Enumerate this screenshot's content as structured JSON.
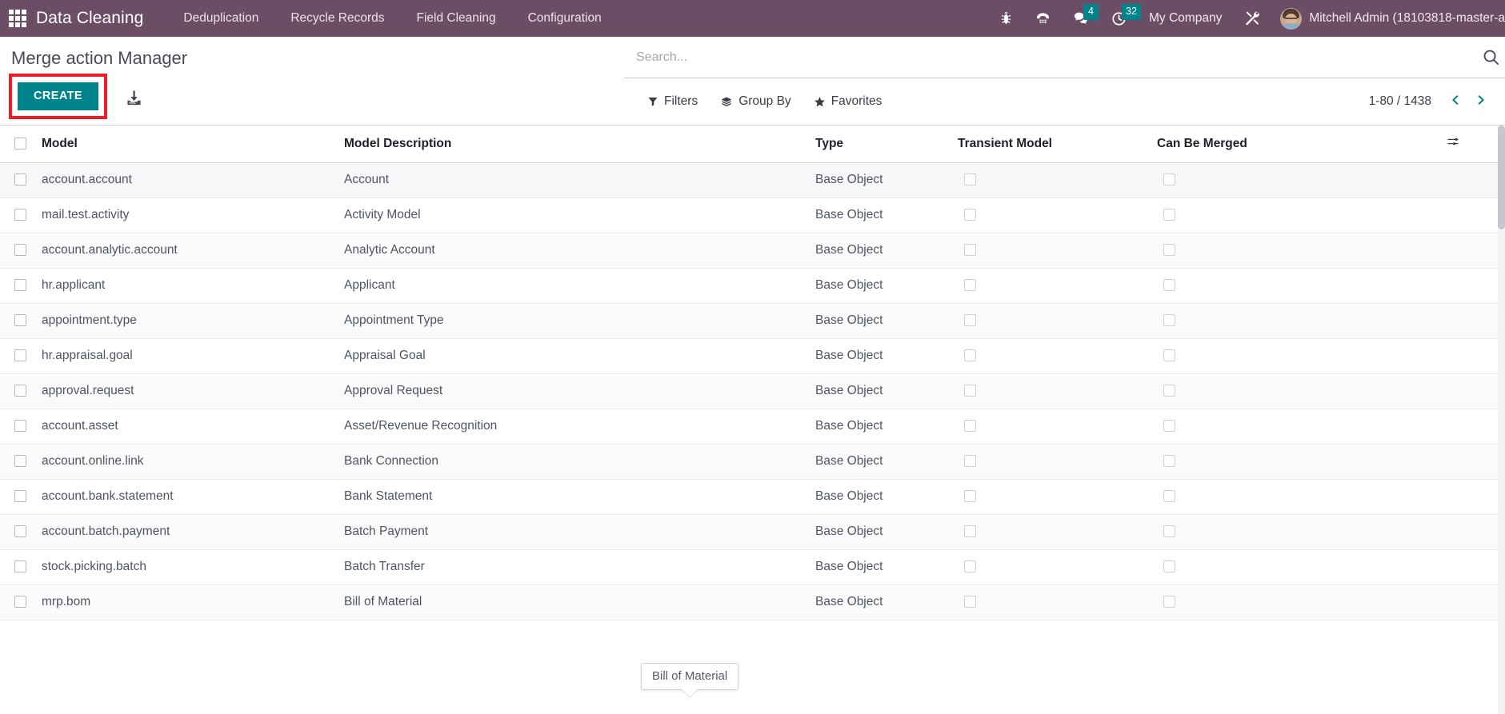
{
  "navbar": {
    "apps_icon": "apps-grid-icon",
    "brand": "Data Cleaning",
    "menu": [
      {
        "label": "Deduplication"
      },
      {
        "label": "Recycle Records"
      },
      {
        "label": "Field Cleaning"
      },
      {
        "label": "Configuration"
      }
    ],
    "systray": [
      {
        "name": "bug-icon",
        "badge": null
      },
      {
        "name": "voip-phone-icon",
        "badge": null
      },
      {
        "name": "messaging-chat-icon",
        "badge": "4"
      },
      {
        "name": "activities-clock-icon",
        "badge": "32"
      }
    ],
    "company": "My Company",
    "debug_tools_icon": "wrench-screwdriver-icon",
    "username": "Mitchell Admin (18103818-master-a",
    "bar_color": "#6b4e66",
    "badge_color": "#00848c"
  },
  "control_panel": {
    "breadcrumb": "Merge action Manager",
    "create_label": "CREATE",
    "create_color": "#00848c",
    "highlight_color": "#f01b26",
    "import_icon": "import-download-icon",
    "search": {
      "placeholder": "Search...",
      "value": "",
      "search_icon": "search-magnifier-icon"
    },
    "filters": [
      {
        "label": "Filters",
        "icon": "filter-funnel-icon"
      },
      {
        "label": "Group By",
        "icon": "group-by-layers-icon"
      },
      {
        "label": "Favorites",
        "icon": "favorites-star-icon"
      }
    ],
    "pager": {
      "value": "1-80 / 1438",
      "prev_icon": "chevron-left-icon",
      "next_icon": "chevron-right-icon",
      "accent": "#017e84"
    }
  },
  "list": {
    "select_all_checkbox": false,
    "optional_columns_icon": "optional-columns-sliders-icon",
    "columns": [
      {
        "key": "model",
        "label": "Model"
      },
      {
        "key": "description",
        "label": "Model Description"
      },
      {
        "key": "type",
        "label": "Type"
      },
      {
        "key": "transient",
        "label": "Transient Model"
      },
      {
        "key": "merged",
        "label": "Can Be Merged"
      }
    ],
    "rows": [
      {
        "model": "account.account",
        "description": "Account",
        "type": "Base Object",
        "transient": false,
        "merged": false
      },
      {
        "model": "mail.test.activity",
        "description": "Activity Model",
        "type": "Base Object",
        "transient": false,
        "merged": false
      },
      {
        "model": "account.analytic.account",
        "description": "Analytic Account",
        "type": "Base Object",
        "transient": false,
        "merged": false
      },
      {
        "model": "hr.applicant",
        "description": "Applicant",
        "type": "Base Object",
        "transient": false,
        "merged": false
      },
      {
        "model": "appointment.type",
        "description": "Appointment Type",
        "type": "Base Object",
        "transient": false,
        "merged": false
      },
      {
        "model": "hr.appraisal.goal",
        "description": "Appraisal Goal",
        "type": "Base Object",
        "transient": false,
        "merged": false
      },
      {
        "model": "approval.request",
        "description": "Approval Request",
        "type": "Base Object",
        "transient": false,
        "merged": false
      },
      {
        "model": "account.asset",
        "description": "Asset/Revenue Recognition",
        "type": "Base Object",
        "transient": false,
        "merged": false
      },
      {
        "model": "account.online.link",
        "description": "Bank Connection",
        "type": "Base Object",
        "transient": false,
        "merged": false
      },
      {
        "model": "account.bank.statement",
        "description": "Bank Statement",
        "type": "Base Object",
        "transient": false,
        "merged": false
      },
      {
        "model": "account.batch.payment",
        "description": "Batch Payment",
        "type": "Base Object",
        "transient": false,
        "merged": false
      },
      {
        "model": "stock.picking.batch",
        "description": "Batch Transfer",
        "type": "Base Object",
        "transient": false,
        "merged": false
      },
      {
        "model": "mrp.bom",
        "description": "Bill of Material",
        "type": "Base Object",
        "transient": false,
        "merged": false
      }
    ]
  },
  "tooltip": {
    "text": "Bill of Material"
  }
}
